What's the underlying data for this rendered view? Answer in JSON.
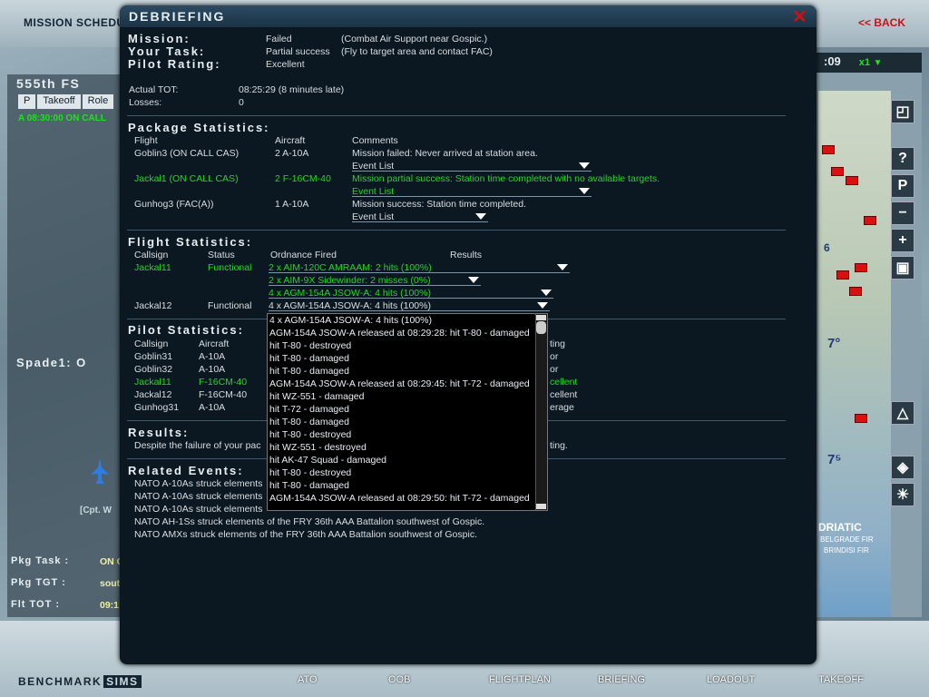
{
  "background": {
    "top_title": "MISSION SCHEDULE",
    "back_label": "<< BACK",
    "squadron": "555th FS",
    "tabs": [
      "P",
      "Takeoff",
      "Role"
    ],
    "flight_row": "A   08:30:00   ON CALL",
    "flight_name": "Spade1: O",
    "pilot_rank": "[Cpt. W",
    "pkg_task_label": "Pkg Task :",
    "pkg_task_value": "ON C",
    "pkg_tgt_label": "Pkg TGT :",
    "pkg_tgt_value": "sout",
    "flt_tot_label": "Flt TOT :",
    "flt_tot_value": "09:1",
    "clock": ":09",
    "time_accel": "x1",
    "brand": "BENCHMARK",
    "brand_suffix": "SIMS",
    "nav": [
      "ATO",
      "OOB",
      "FLIGHTPLAN",
      "BRIEFING",
      "LOADOUT",
      "TAKEOFF"
    ],
    "map_labels": [
      "6",
      "7°",
      "7⁵",
      "DRIATIC",
      "BELGRADE FIR",
      "BRINDISI FIR"
    ]
  },
  "dialog": {
    "title": "DEBRIEFING",
    "mission_label": "Mission:",
    "mission_result": "Failed",
    "mission_desc": "(Combat Air Support near Gospic.)",
    "task_label": "Your Task:",
    "task_result": "Partial success",
    "task_desc": "(Fly to target area and contact FAC)",
    "rating_label": "Pilot Rating:",
    "rating_value": "Excellent",
    "tot_label": "Actual TOT:",
    "tot_value": "08:25:29 (8 minutes late)",
    "losses_label": "Losses:",
    "losses_value": "0",
    "package_title": "Package Statistics:",
    "package_headers": [
      "Flight",
      "Aircraft",
      "Comments"
    ],
    "package_rows": [
      {
        "flight": "Goblin3 (ON CALL CAS)",
        "aircraft": "2 A-10A",
        "comment": "Mission failed: Never arrived at station area.",
        "event": "Event List"
      },
      {
        "flight": "Jackal1 (ON CALL CAS)",
        "aircraft": "2 F-16CM-40",
        "comment": "Mission partial success: Station time completed with no available targets.",
        "event": "Event List"
      },
      {
        "flight": "Gunhog3 (FAC(A))",
        "aircraft": "1 A-10A",
        "comment": "Mission success: Station time completed.",
        "event": "Event List"
      }
    ],
    "flight_title": "Flight Statistics:",
    "flight_headers": [
      "Callsign",
      "Status",
      "Ordnance Fired",
      "Results"
    ],
    "flight_rows": [
      {
        "callsign": "Jackal11",
        "status": "Functional",
        "ordnance": [
          "2 x AIM-120C AMRAAM: 2 hits (100%)",
          "2 x AIM-9X Sidewinder: 2 misses (0%)",
          "4 x AGM-154A JSOW-A: 4 hits (100%)"
        ]
      },
      {
        "callsign": "Jackal12",
        "status": "Functional",
        "ordnance": [
          "4 x AGM-154A JSOW-A: 4 hits (100%)"
        ]
      }
    ],
    "pilot_title": "Pilot Statistics:",
    "pilot_headers": [
      "Callsign",
      "Aircraft"
    ],
    "pilot_rows": [
      {
        "callsign": "Goblin31",
        "aircraft": "A-10A",
        "rating": "or"
      },
      {
        "callsign": "Goblin32",
        "aircraft": "A-10A",
        "rating": "or"
      },
      {
        "callsign": "Jackal11",
        "aircraft": "F-16CM-40",
        "rating": "cellent"
      },
      {
        "callsign": "Jackal12",
        "aircraft": "F-16CM-40",
        "rating": "cellent"
      },
      {
        "callsign": "Gunhog31",
        "aircraft": "A-10A",
        "rating": "erage"
      }
    ],
    "pilot_rating_header": "ting",
    "results_title": "Results:",
    "results_text": "Despite the failure of your pac",
    "results_tail": "ting.",
    "related_title": "Related Events:",
    "related_events": [
      "NATO A-10As struck elements",
      "NATO A-10As struck elements",
      "NATO A-10As struck elements",
      "NATO AH-1Ss struck elements of the FRY 36th AAA Battalion southwest of Gospic.",
      "NATO AMXs struck elements of the FRY 36th AAA Battalion southwest of Gospic."
    ]
  },
  "ordnance_list": {
    "items": [
      "4 x AGM-154A JSOW-A: 4 hits (100%)",
      "AGM-154A JSOW-A released at 08:29:28: hit T-80 - damaged",
      "  hit T-80 - destroyed",
      "  hit T-80 - damaged",
      "  hit T-80 - damaged",
      "AGM-154A JSOW-A released at 08:29:45: hit T-72 - damaged",
      "  hit WZ-551 - damaged",
      "  hit T-72 - damaged",
      "  hit T-80 - damaged",
      "  hit T-80 - destroyed",
      "  hit WZ-551 - destroyed",
      "  hit AK-47 Squad - damaged",
      "  hit T-80 - destroyed",
      "  hit T-80 - damaged",
      "AGM-154A JSOW-A released at 08:29:50: hit T-72 - damaged"
    ]
  },
  "colors": {
    "accent_green": "#20d820",
    "close_red": "#d01010",
    "back_red": "#c8101a"
  }
}
